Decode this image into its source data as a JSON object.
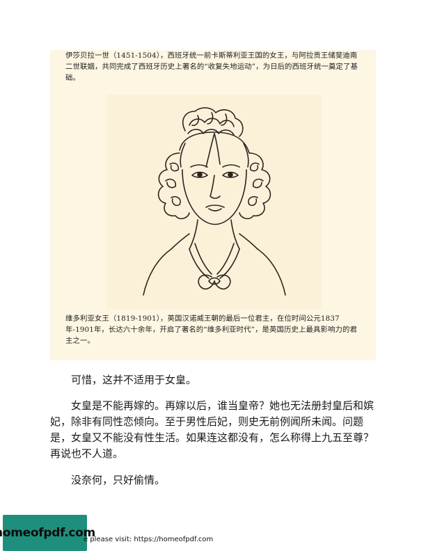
{
  "captions": {
    "isabella": "伊莎贝拉一世（1451-1504），西班牙统一前卡斯蒂利亚王国的女王，与阿拉贡王储斐迪南二世联姻，共同完成了西班牙历史上著名的“收复失地运动”，为日后的西班牙统一奠定了基础。",
    "victoria": "维多利亚女王（1819-1901），英国汉诺威王朝的最后一位君主，在位时间公元1837年-1901年，长达六十余年，开启了著名的“维多利亚时代”，是英国历史上最具影响力的君主之一。"
  },
  "body": {
    "p1": "可惜，这并不适用于女皇。",
    "p2": "女皇是不能再嫁的。再嫁以后，谁当皇帝？她也无法册封皇后和嫔妃，除非有同性恋倾向。至于男性后妃，则史无前例闻所未闻。问题是，女皇又不能没有性生活。如果连这都没有，怎么称得上九五至尊？再说也不人道。",
    "p3": "没奈何，只好偷情。"
  },
  "footer": {
    "logo": "homeofpdf.com",
    "text": "e please visit: https://homeofpdf.com"
  },
  "colors": {
    "panel": "#fdf6e3",
    "logo_bg": "#1f8f7d",
    "ink": "#2b2420"
  }
}
